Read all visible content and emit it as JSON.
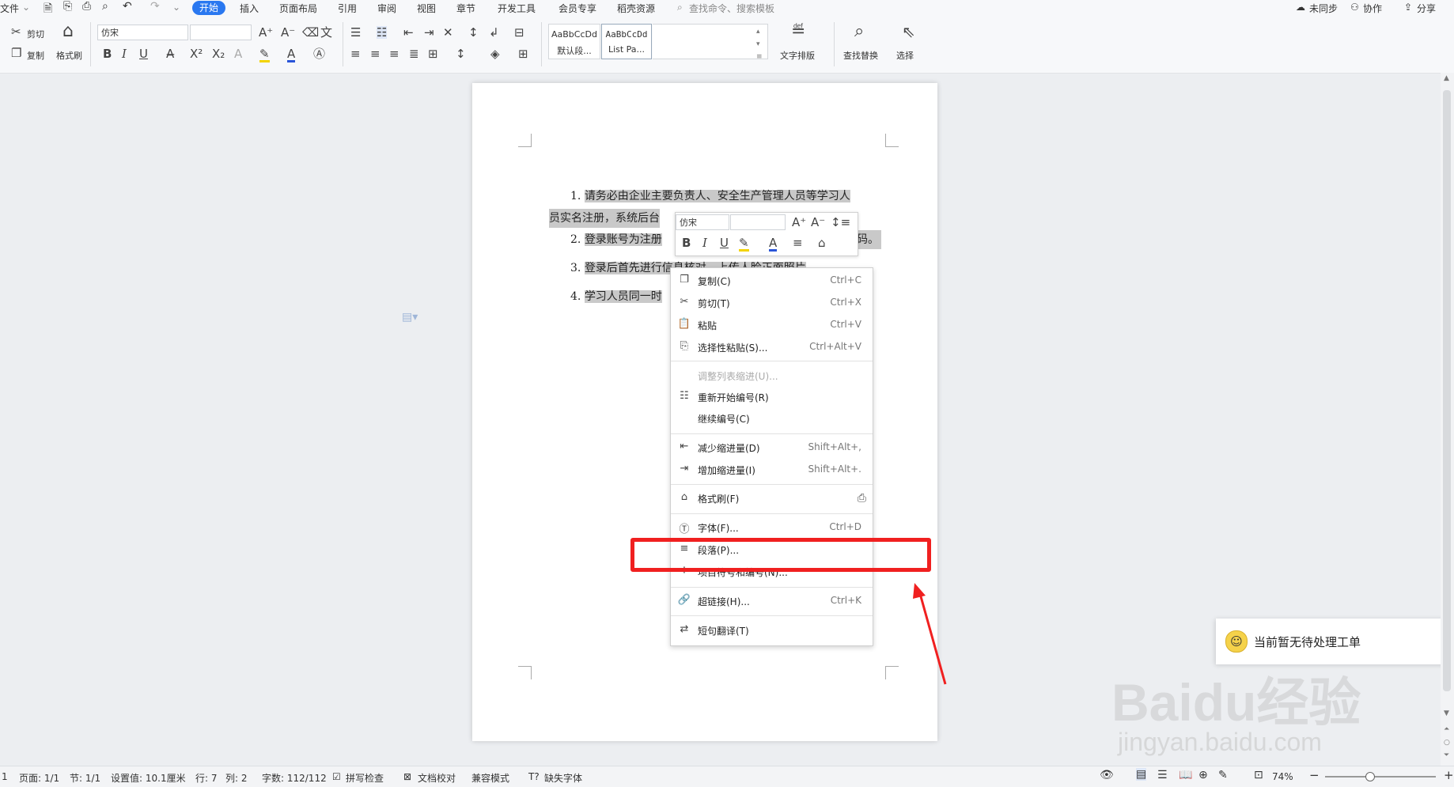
{
  "menu": {
    "file": "文件",
    "tabs": [
      "开始",
      "插入",
      "页面布局",
      "引用",
      "审阅",
      "视图",
      "章节",
      "开发工具",
      "会员专享",
      "稻壳资源"
    ],
    "active_tab": "开始",
    "search_placeholder": "查找命令、搜索模板",
    "right": {
      "sync": "未同步",
      "collab": "协作",
      "share": "分享"
    }
  },
  "ribbon": {
    "cut": "剪切",
    "copy": "复制",
    "format_painter": "格式刷",
    "font_name": "仿宋",
    "font_size": "",
    "style1_sample": "AaBbCcDd",
    "style1_name": "默认段...",
    "style2_sample": "AaBbCcDd",
    "style2_name": "List Pa...",
    "text_layout": "文字排版",
    "find_replace": "查找替换",
    "select": "选择"
  },
  "document": {
    "items": [
      {
        "num": "1.",
        "text": "请务必由企业主要负责人、安全生产管理人员等学习人",
        "cont": "员实名注册，系统后台"
      },
      {
        "num": "2.",
        "text": "登录账号为注册",
        "tail": "码。"
      },
      {
        "num": "3.",
        "text": "登录后首先进行信息核对，上传人脸正面照片"
      },
      {
        "num": "4.",
        "text": "学习人员同一时"
      }
    ]
  },
  "minibar": {
    "font": "仿宋",
    "size": ""
  },
  "context_menu": [
    {
      "icon": "copy-icon",
      "label": "复制(C)",
      "shortcut": "Ctrl+C",
      "disabled": false
    },
    {
      "icon": "scissors-icon",
      "label": "剪切(T)",
      "shortcut": "Ctrl+X",
      "disabled": false
    },
    {
      "icon": "paste-icon",
      "label": "粘贴",
      "shortcut": "Ctrl+V",
      "disabled": false
    },
    {
      "icon": "paste-special-icon",
      "label": "选择性粘贴(S)...",
      "shortcut": "Ctrl+Alt+V",
      "disabled": false
    },
    {
      "icon": "",
      "label": "调整列表缩进(U)...",
      "shortcut": "",
      "disabled": true
    },
    {
      "icon": "restart-numbering-icon",
      "label": "重新开始编号(R)",
      "shortcut": "",
      "disabled": false
    },
    {
      "icon": "",
      "label": "继续编号(C)",
      "shortcut": "",
      "disabled": false
    },
    {
      "icon": "decrease-indent-icon",
      "label": "减少缩进量(D)",
      "shortcut": "Shift+Alt+,",
      "disabled": false
    },
    {
      "icon": "increase-indent-icon",
      "label": "增加缩进量(I)",
      "shortcut": "Shift+Alt+.",
      "disabled": false
    },
    {
      "icon": "format-painter-icon",
      "label": "格式刷(F)",
      "shortcut": "",
      "disabled": false
    },
    {
      "icon": "font-icon",
      "label": "字体(F)...",
      "shortcut": "Ctrl+D",
      "disabled": false
    },
    {
      "icon": "paragraph-icon",
      "label": "段落(P)...",
      "shortcut": "",
      "disabled": false
    },
    {
      "icon": "bullets-numbering-icon",
      "label": "项目符号和编号(N)...",
      "shortcut": "",
      "disabled": false
    },
    {
      "icon": "hyperlink-icon",
      "label": "超链接(H)...",
      "shortcut": "Ctrl+K",
      "disabled": false
    },
    {
      "icon": "translate-icon",
      "label": "短句翻译(T)",
      "shortcut": "",
      "disabled": false
    }
  ],
  "notification": {
    "text": "当前暂无待处理工单"
  },
  "watermark": {
    "logo": "Baidu经验",
    "url": "jingyan.baidu.com"
  },
  "status": {
    "page_num": "1",
    "page": "页面: 1/1",
    "section": "节: 1/1",
    "setting": "设置值: 10.1厘米",
    "row": "行: 7",
    "col": "列: 2",
    "words": "字数: 112/112",
    "spell": "拼写检查",
    "proof": "文档校对",
    "compat": "兼容模式",
    "missing_font": "缺失字体",
    "zoom": "74%"
  },
  "colors": {
    "accent": "#2a78f0",
    "highlight_red": "#f02020",
    "selection": "#c9c9c9"
  }
}
